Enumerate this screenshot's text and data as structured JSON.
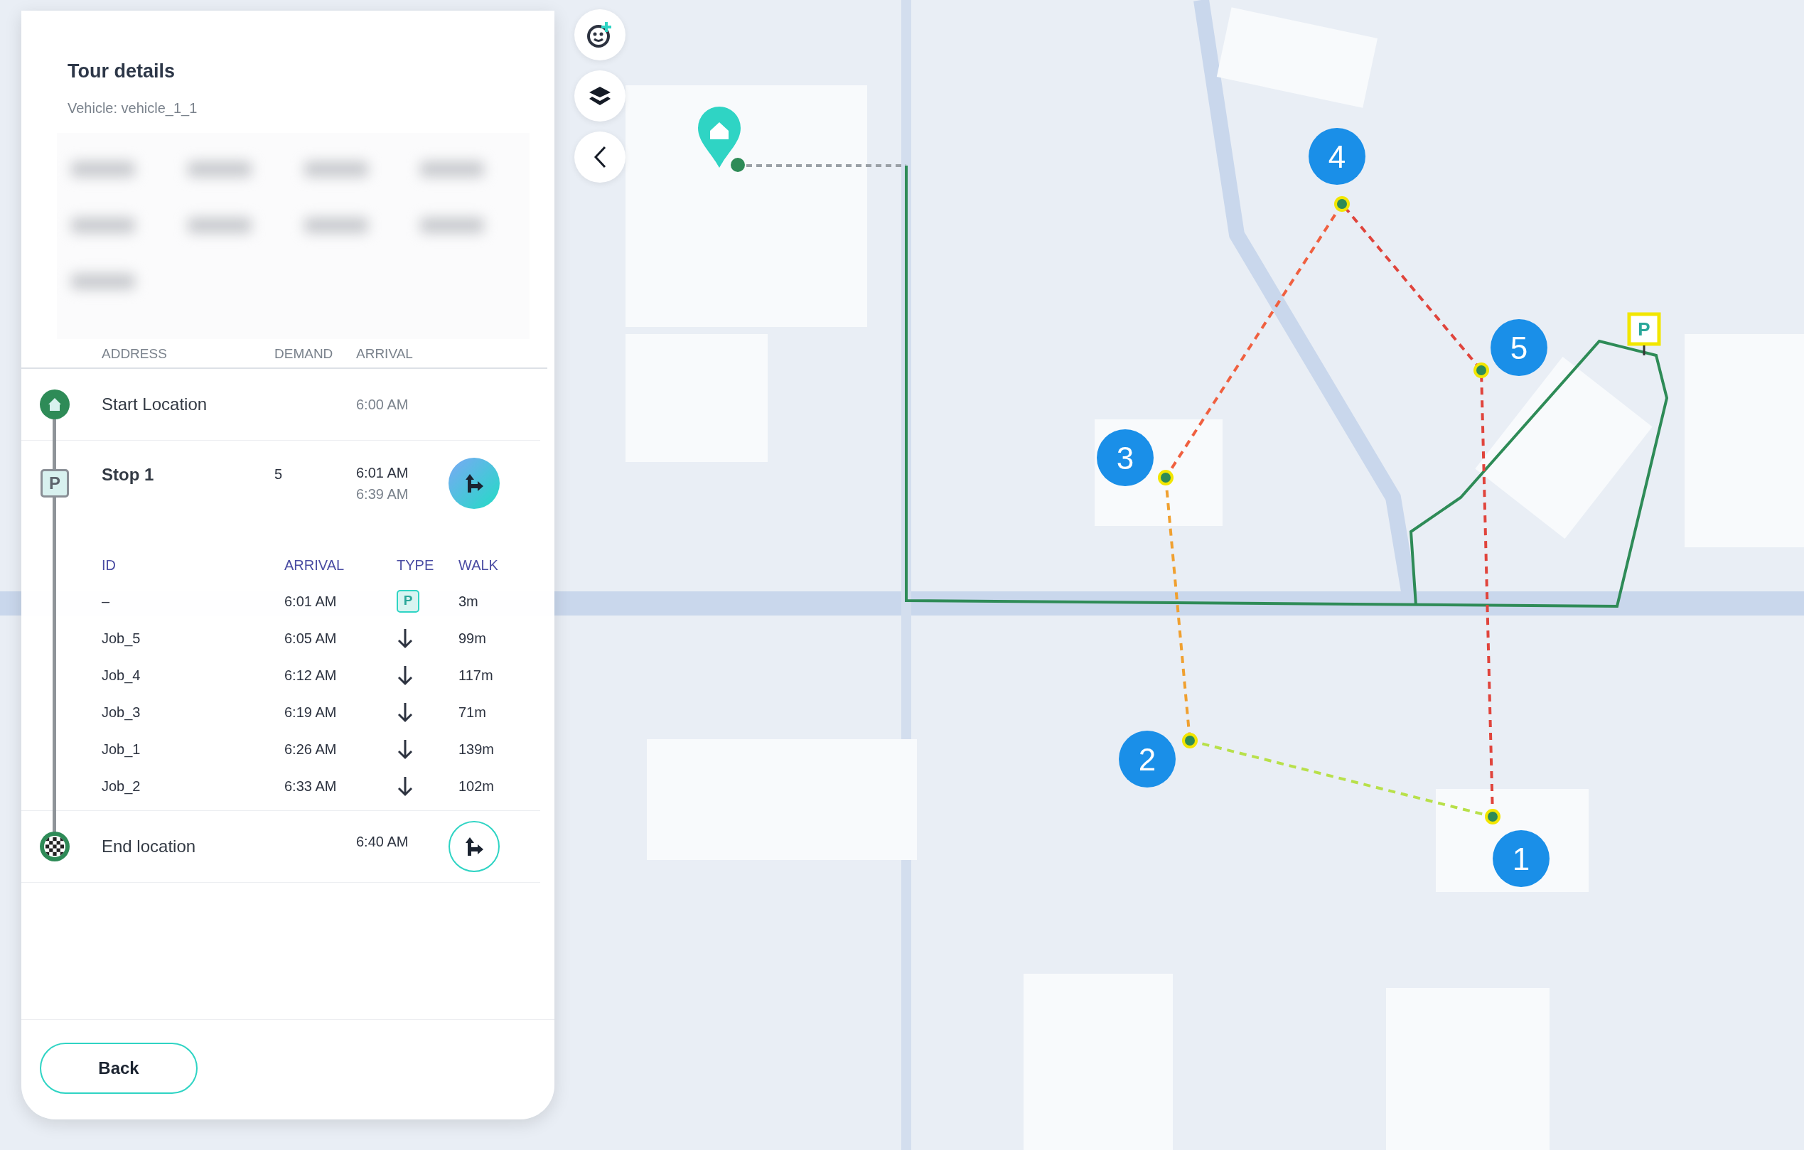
{
  "panel": {
    "title": "Tour details",
    "subtitle": "Vehicle: vehicle_1_1",
    "columns": [
      "ADDRESS",
      "DEMAND",
      "ARRIVAL"
    ],
    "stops": [
      {
        "kind": "start",
        "address": "Start Location",
        "arrival": "6:00 AM"
      },
      {
        "kind": "parking",
        "badge": "P",
        "address": "Stop 1",
        "demand": "5",
        "arrival": "6:01 AM",
        "departure": "6:39 AM",
        "expanded": true,
        "job_columns": [
          "ID",
          "ARRIVAL",
          "TYPE",
          "WALK"
        ],
        "jobs": [
          {
            "id": "–",
            "arrival": "6:01 AM",
            "kind": "parking",
            "badge": "P",
            "walk": "3m"
          },
          {
            "id": "Job_5",
            "arrival": "6:05 AM",
            "kind": "delivery",
            "walk": "99m"
          },
          {
            "id": "Job_4",
            "arrival": "6:12 AM",
            "kind": "delivery",
            "walk": "117m"
          },
          {
            "id": "Job_3",
            "arrival": "6:19 AM",
            "kind": "delivery",
            "walk": "71m"
          },
          {
            "id": "Job_1",
            "arrival": "6:26 AM",
            "kind": "delivery",
            "walk": "139m"
          },
          {
            "id": "Job_2",
            "arrival": "6:33 AM",
            "kind": "delivery",
            "walk": "102m"
          }
        ]
      },
      {
        "kind": "end",
        "address": "End location",
        "arrival": "6:40 AM",
        "expanded": false
      }
    ],
    "back_button": "Back"
  },
  "map": {
    "parking_label": "P",
    "markers": [
      {
        "label": "1"
      },
      {
        "label": "2"
      },
      {
        "label": "3"
      },
      {
        "label": "4"
      },
      {
        "label": "5"
      }
    ]
  }
}
